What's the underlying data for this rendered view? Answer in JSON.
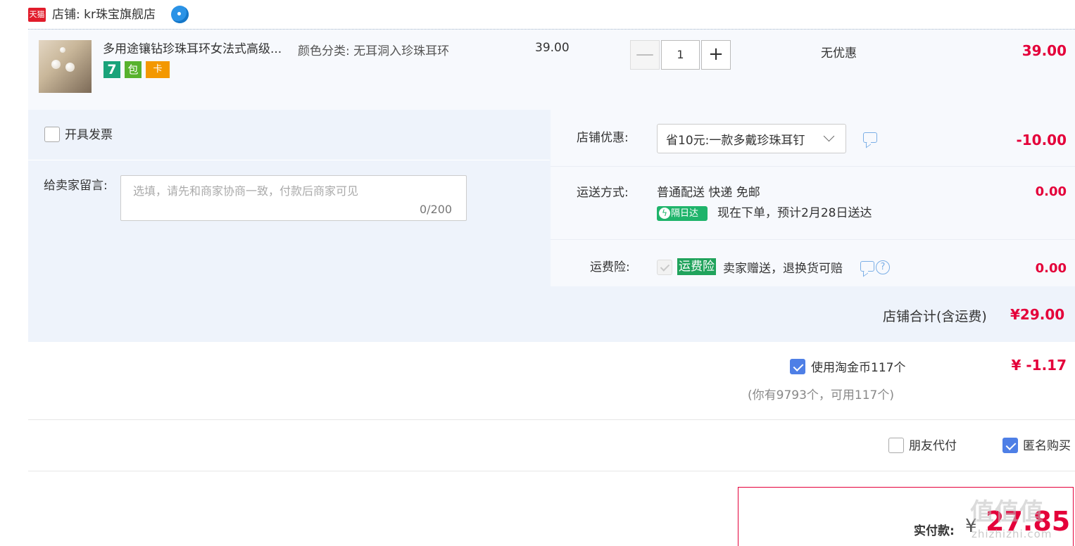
{
  "shop": {
    "badge": "天猫",
    "name": "店铺: kr珠宝旗舰店",
    "wangwang_icon": "wangwang-chat-icon"
  },
  "item": {
    "title": "多用途镶钻珍珠耳环女法式高级...",
    "sku": "颜色分类: 无耳洞入珍珠耳环",
    "tags": [
      "7",
      "包",
      "卡"
    ],
    "unit_price": "39.00",
    "qty_minus": "—",
    "qty": "1",
    "qty_plus": "+",
    "discount": "无优惠",
    "subtotal": "39.00"
  },
  "options": {
    "invoice_label": "开具发票",
    "invoice_checked": false,
    "message_label": "给卖家留言:",
    "message_placeholder": "选填，请先和商家协商一致，付款后商家可见",
    "message_count": "0/200",
    "store_coupon_label": "店铺优惠:",
    "store_coupon_value": "省10元:一款多戴珍珠耳钉",
    "store_coupon_amount": "-10.00",
    "shipping_label": "运送方式:",
    "shipping_value": "普通配送 快递 免邮",
    "nextday_badge": "隔日达",
    "nextday_text": "现在下单，预计2月28日送达",
    "shipping_amount": "0.00",
    "insurance_label": "运费险:",
    "insurance_badge": "运费险",
    "insurance_text": "卖家赠送，退换货可赔",
    "insurance_amount": "0.00",
    "store_total_label": "店铺合计(含运费)",
    "store_total": "¥29.00"
  },
  "coins": {
    "label": "使用淘金币117个",
    "checked": true,
    "note": "(你有9793个，可用117个)",
    "amount": "¥ -1.17"
  },
  "extras": {
    "friend_pay": "朋友代付",
    "friend_pay_checked": false,
    "anonymous": "匿名购买",
    "anonymous_checked": true
  },
  "final": {
    "label": "实付款:",
    "currency": "¥",
    "amount": "27.85"
  },
  "watermark": {
    "logo": "值值值",
    "url": "zhizhizhi.com"
  },
  "colors": {
    "price_red": "#e4003a",
    "checkbox_blue": "#4e7fe6",
    "tmall_red": "#e11c2b",
    "nextday_green": "#1fb46b"
  }
}
